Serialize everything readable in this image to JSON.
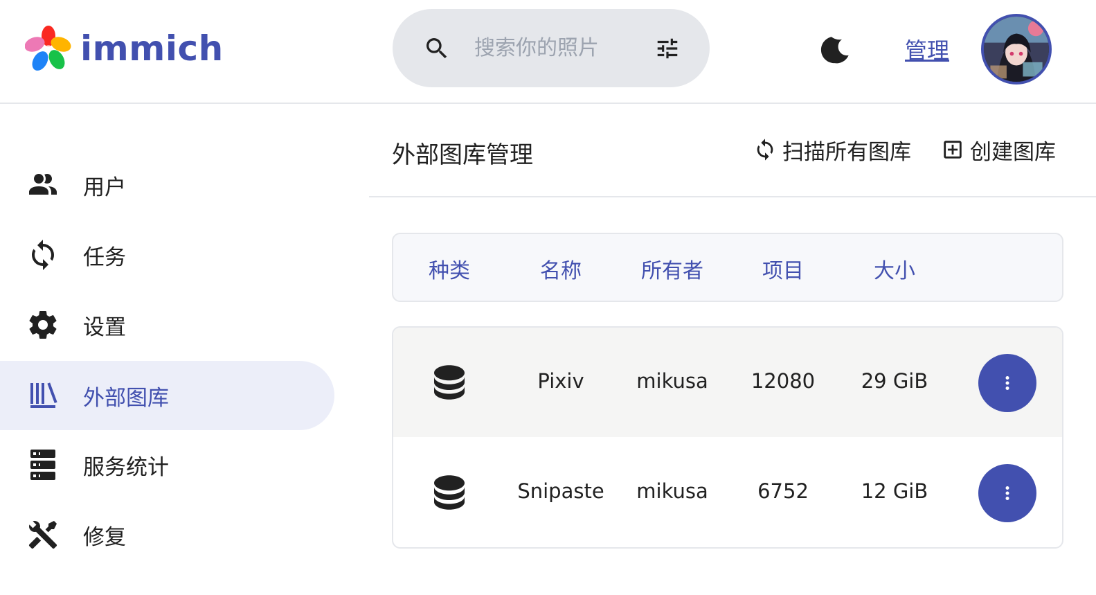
{
  "app": {
    "name": "immich"
  },
  "colors": {
    "accent": "#4250af",
    "active_bg": "#eceef9",
    "search_bg": "#e5e7eb"
  },
  "header": {
    "search_placeholder": "搜索你的照片",
    "admin_label": "管理",
    "icons": {
      "search": "search-icon",
      "filter": "tune-icon",
      "theme": "moon-icon"
    }
  },
  "sidebar": {
    "items": [
      {
        "label": "用户",
        "icon": "users-icon",
        "active": false
      },
      {
        "label": "任务",
        "icon": "sync-icon",
        "active": false
      },
      {
        "label": "设置",
        "icon": "gear-icon",
        "active": false
      },
      {
        "label": "外部图库",
        "icon": "library-icon",
        "active": true
      },
      {
        "label": "服务统计",
        "icon": "server-icon",
        "active": false
      },
      {
        "label": "修复",
        "icon": "tools-icon",
        "active": false
      }
    ]
  },
  "main": {
    "title": "外部图库管理",
    "scan_all_label": "扫描所有图库",
    "create_label": "创建图库",
    "table": {
      "headers": [
        "种类",
        "名称",
        "所有者",
        "项目",
        "大小"
      ],
      "rows": [
        {
          "type_icon": "database-icon",
          "name": "Pixiv",
          "owner": "mikusa",
          "items": "12080",
          "size": "29 GiB"
        },
        {
          "type_icon": "database-icon",
          "name": "Snipaste",
          "owner": "mikusa",
          "items": "6752",
          "size": "12 GiB"
        }
      ]
    }
  }
}
